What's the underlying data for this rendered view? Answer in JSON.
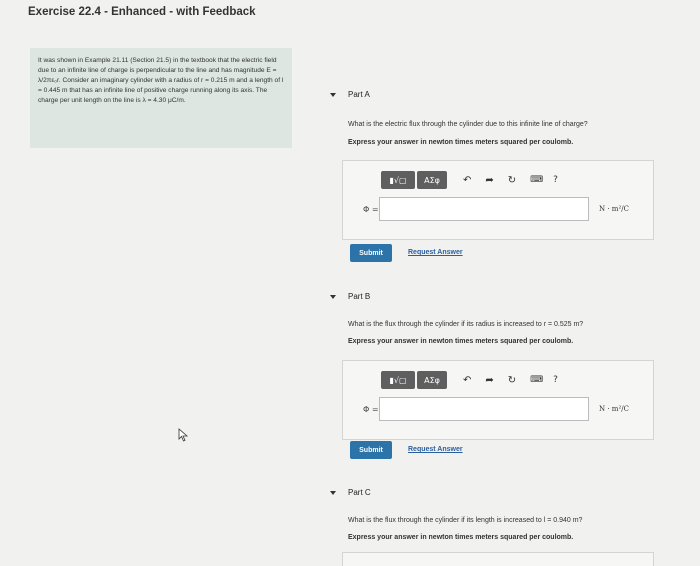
{
  "page": {
    "title": "Exercise 22.4 - Enhanced - with Feedback"
  },
  "context": {
    "text": "It was shown in Example 21.11 (Section 21.5) in the textbook that the electric field due to an infinite line of charge is perpendicular to the line and has magnitude E = λ/2πε₀r. Consider an imaginary cylinder with a radius of r = 0.215 m and a length of l = 0.445 m that has an infinite line of positive charge running along its axis. The charge per unit length on the line is λ = 4.30 μC/m."
  },
  "toolbar": {
    "templates_label": "▮√▢",
    "greek_label": "ΑΣφ",
    "undo_icon": "undo-icon",
    "redo_icon": "redo-icon",
    "reset_icon": "reset-icon",
    "keyboard_icon": "keyboard-icon",
    "help_label": "?"
  },
  "parts": [
    {
      "label": "Part A",
      "question": "What is the electric flux through the cylinder due to this infinite line of charge?",
      "instruction": "Express your answer in newton times meters squared per coulomb.",
      "symbol": "Φ =",
      "units": "N · m²/C",
      "value": "",
      "submit": "Submit",
      "request": "Request Answer"
    },
    {
      "label": "Part B",
      "question": "What is the flux through the cylinder if its radius is increased to r = 0.525 m?",
      "instruction": "Express your answer in newton times meters squared per coulomb.",
      "symbol": "Φ =",
      "units": "N · m²/C",
      "value": "",
      "submit": "Submit",
      "request": "Request Answer"
    },
    {
      "label": "Part C",
      "question": "What is the flux through the cylinder if its length is increased to l = 0.940 m?",
      "instruction": "Express your answer in newton times meters squared per coulomb."
    }
  ]
}
